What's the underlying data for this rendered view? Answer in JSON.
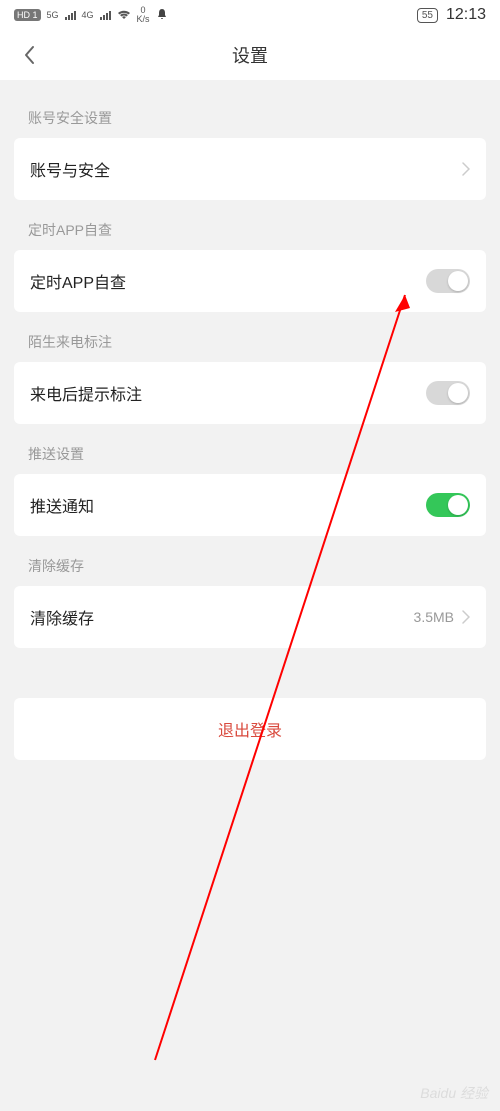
{
  "status_bar": {
    "hd_badge": "HD 1",
    "net1": "5G",
    "net2": "4G",
    "speed_top": "0",
    "speed_unit": "K/s",
    "battery": "55",
    "time": "12:13"
  },
  "header": {
    "title": "设置"
  },
  "sections": {
    "account_security": {
      "header": "账号安全设置",
      "item_label": "账号与安全"
    },
    "app_check": {
      "header": "定时APP自查",
      "item_label": "定时APP自查",
      "toggle_on": false
    },
    "caller_id": {
      "header": "陌生来电标注",
      "item_label": "来电后提示标注",
      "toggle_on": false
    },
    "push": {
      "header": "推送设置",
      "item_label": "推送通知",
      "toggle_on": true
    },
    "cache": {
      "header": "清除缓存",
      "item_label": "清除缓存",
      "value": "3.5MB"
    }
  },
  "logout": {
    "label": "退出登录"
  },
  "watermark": "Baidu 经验"
}
